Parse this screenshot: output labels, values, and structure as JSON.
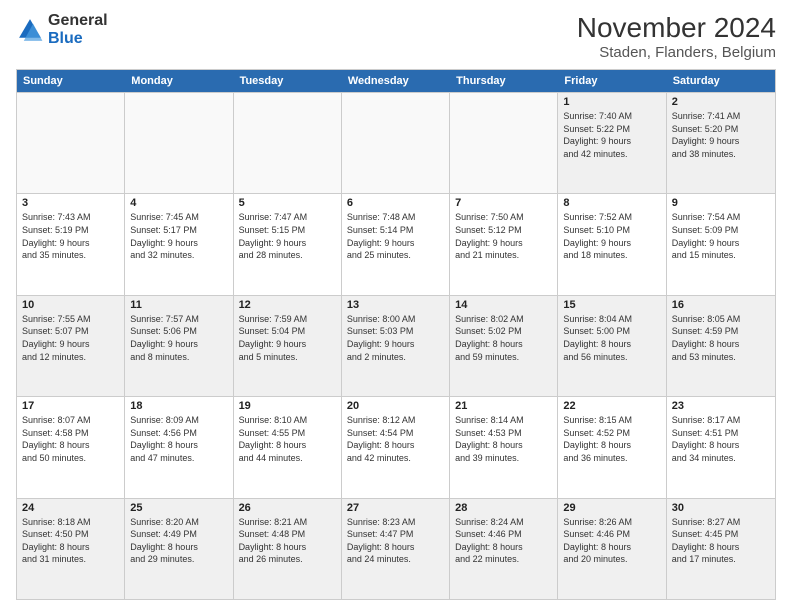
{
  "logo": {
    "line1": "General",
    "line2": "Blue"
  },
  "title": "November 2024",
  "subtitle": "Staden, Flanders, Belgium",
  "days_of_week": [
    "Sunday",
    "Monday",
    "Tuesday",
    "Wednesday",
    "Thursday",
    "Friday",
    "Saturday"
  ],
  "weeks": [
    [
      {
        "day": "",
        "info": ""
      },
      {
        "day": "",
        "info": ""
      },
      {
        "day": "",
        "info": ""
      },
      {
        "day": "",
        "info": ""
      },
      {
        "day": "",
        "info": ""
      },
      {
        "day": "1",
        "info": "Sunrise: 7:40 AM\nSunset: 5:22 PM\nDaylight: 9 hours\nand 42 minutes."
      },
      {
        "day": "2",
        "info": "Sunrise: 7:41 AM\nSunset: 5:20 PM\nDaylight: 9 hours\nand 38 minutes."
      }
    ],
    [
      {
        "day": "3",
        "info": "Sunrise: 7:43 AM\nSunset: 5:19 PM\nDaylight: 9 hours\nand 35 minutes."
      },
      {
        "day": "4",
        "info": "Sunrise: 7:45 AM\nSunset: 5:17 PM\nDaylight: 9 hours\nand 32 minutes."
      },
      {
        "day": "5",
        "info": "Sunrise: 7:47 AM\nSunset: 5:15 PM\nDaylight: 9 hours\nand 28 minutes."
      },
      {
        "day": "6",
        "info": "Sunrise: 7:48 AM\nSunset: 5:14 PM\nDaylight: 9 hours\nand 25 minutes."
      },
      {
        "day": "7",
        "info": "Sunrise: 7:50 AM\nSunset: 5:12 PM\nDaylight: 9 hours\nand 21 minutes."
      },
      {
        "day": "8",
        "info": "Sunrise: 7:52 AM\nSunset: 5:10 PM\nDaylight: 9 hours\nand 18 minutes."
      },
      {
        "day": "9",
        "info": "Sunrise: 7:54 AM\nSunset: 5:09 PM\nDaylight: 9 hours\nand 15 minutes."
      }
    ],
    [
      {
        "day": "10",
        "info": "Sunrise: 7:55 AM\nSunset: 5:07 PM\nDaylight: 9 hours\nand 12 minutes."
      },
      {
        "day": "11",
        "info": "Sunrise: 7:57 AM\nSunset: 5:06 PM\nDaylight: 9 hours\nand 8 minutes."
      },
      {
        "day": "12",
        "info": "Sunrise: 7:59 AM\nSunset: 5:04 PM\nDaylight: 9 hours\nand 5 minutes."
      },
      {
        "day": "13",
        "info": "Sunrise: 8:00 AM\nSunset: 5:03 PM\nDaylight: 9 hours\nand 2 minutes."
      },
      {
        "day": "14",
        "info": "Sunrise: 8:02 AM\nSunset: 5:02 PM\nDaylight: 8 hours\nand 59 minutes."
      },
      {
        "day": "15",
        "info": "Sunrise: 8:04 AM\nSunset: 5:00 PM\nDaylight: 8 hours\nand 56 minutes."
      },
      {
        "day": "16",
        "info": "Sunrise: 8:05 AM\nSunset: 4:59 PM\nDaylight: 8 hours\nand 53 minutes."
      }
    ],
    [
      {
        "day": "17",
        "info": "Sunrise: 8:07 AM\nSunset: 4:58 PM\nDaylight: 8 hours\nand 50 minutes."
      },
      {
        "day": "18",
        "info": "Sunrise: 8:09 AM\nSunset: 4:56 PM\nDaylight: 8 hours\nand 47 minutes."
      },
      {
        "day": "19",
        "info": "Sunrise: 8:10 AM\nSunset: 4:55 PM\nDaylight: 8 hours\nand 44 minutes."
      },
      {
        "day": "20",
        "info": "Sunrise: 8:12 AM\nSunset: 4:54 PM\nDaylight: 8 hours\nand 42 minutes."
      },
      {
        "day": "21",
        "info": "Sunrise: 8:14 AM\nSunset: 4:53 PM\nDaylight: 8 hours\nand 39 minutes."
      },
      {
        "day": "22",
        "info": "Sunrise: 8:15 AM\nSunset: 4:52 PM\nDaylight: 8 hours\nand 36 minutes."
      },
      {
        "day": "23",
        "info": "Sunrise: 8:17 AM\nSunset: 4:51 PM\nDaylight: 8 hours\nand 34 minutes."
      }
    ],
    [
      {
        "day": "24",
        "info": "Sunrise: 8:18 AM\nSunset: 4:50 PM\nDaylight: 8 hours\nand 31 minutes."
      },
      {
        "day": "25",
        "info": "Sunrise: 8:20 AM\nSunset: 4:49 PM\nDaylight: 8 hours\nand 29 minutes."
      },
      {
        "day": "26",
        "info": "Sunrise: 8:21 AM\nSunset: 4:48 PM\nDaylight: 8 hours\nand 26 minutes."
      },
      {
        "day": "27",
        "info": "Sunrise: 8:23 AM\nSunset: 4:47 PM\nDaylight: 8 hours\nand 24 minutes."
      },
      {
        "day": "28",
        "info": "Sunrise: 8:24 AM\nSunset: 4:46 PM\nDaylight: 8 hours\nand 22 minutes."
      },
      {
        "day": "29",
        "info": "Sunrise: 8:26 AM\nSunset: 4:46 PM\nDaylight: 8 hours\nand 20 minutes."
      },
      {
        "day": "30",
        "info": "Sunrise: 8:27 AM\nSunset: 4:45 PM\nDaylight: 8 hours\nand 17 minutes."
      }
    ]
  ]
}
